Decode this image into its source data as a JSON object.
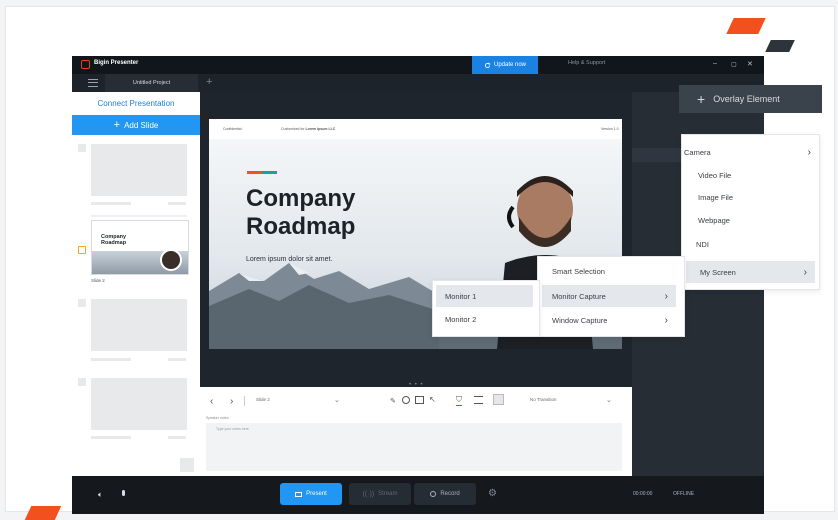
{
  "app": {
    "name": "Bigin Presenter",
    "update_label": "Update now",
    "help_label": "Help & Support",
    "window_controls": [
      "–",
      "▢",
      "✕"
    ]
  },
  "tabs": {
    "project": "Untitled Project",
    "add": "+"
  },
  "left_panel": {
    "connect": "Connect Presentation",
    "add_slide": "Add Slide",
    "slide_label": "Slide 2",
    "thumb_title": "Company Roadmap"
  },
  "slide": {
    "header_left": "Confidential",
    "header_mid_prefix": "Customized for ",
    "header_mid_bold": "Lorem Ipsum LLC",
    "header_right": "Version 1.0",
    "title_line1": "Company",
    "title_line2": "Roadmap",
    "subtitle": "Lorem ipsum dolor sit amet."
  },
  "controls": {
    "slide_select": "Slide 2",
    "transition": "No Transition",
    "notes_label": "Speaker notes",
    "notes_placeholder": "Type your notes here"
  },
  "bottom": {
    "present": "Present",
    "stream": "Stream",
    "record": "Record",
    "timer": "00:00:00",
    "status": "OFFLINE"
  },
  "overlay": {
    "button": "Overlay Element",
    "menu": [
      "Camera",
      "Video File",
      "Image File",
      "Webpage",
      "NDI",
      "My Screen"
    ],
    "screen_submenu": [
      "Smart Selection",
      "Monitor Capture",
      "Window Capture"
    ],
    "monitor_submenu": [
      "Monitor 1",
      "Monitor 2"
    ]
  },
  "colors": {
    "accent": "#2196f3",
    "brand": "#f2501e",
    "dark": "#262d35"
  }
}
